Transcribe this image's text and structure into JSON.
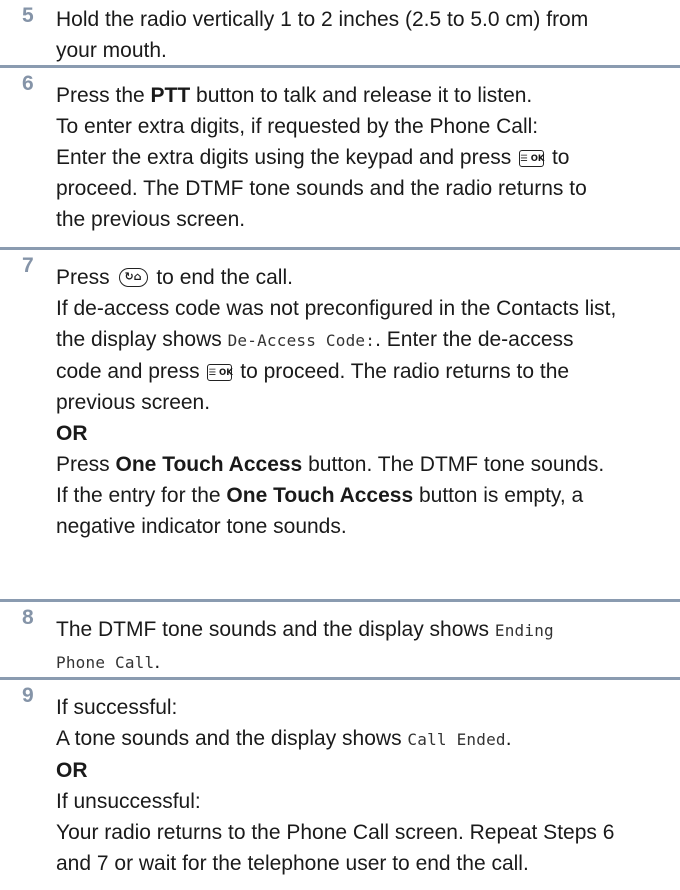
{
  "steps": [
    {
      "num": "5",
      "lines": [
        "Hold the radio vertically 1 to 2 inches (2.5 to 5.0 cm) from",
        "your mouth."
      ]
    },
    {
      "num": "6",
      "l1a": "Press the ",
      "l1b": "PTT",
      "l1c": " button to talk and release it to listen.",
      "l2": "To enter extra digits, if requested by the Phone Call:",
      "l3a": "Enter the extra digits using the keypad and press ",
      "l3b": " to",
      "l4": "proceed. The DTMF tone sounds and the radio returns to",
      "l5": "the previous screen."
    },
    {
      "num": "7",
      "l1a": "Press ",
      "l1b": " to end the call.",
      "l2": "If de-access code was not preconfigured in the Contacts list,",
      "l3a": "the display shows ",
      "l3mono": "De-Access Code:",
      "l3b": ". Enter the de-access",
      "l4a": "code and press ",
      "l4b": " to proceed. The radio returns to the",
      "l5": "previous screen.",
      "or": "OR",
      "l6a": "Press ",
      "l6b": "One Touch Access",
      "l6c": " button. The DTMF tone sounds.",
      "l7a": "If the entry for the ",
      "l7b": "One Touch Access",
      "l7c": " button is empty, a",
      "l8": "negative indicator tone sounds."
    },
    {
      "num": "8",
      "l1a": "The DTMF tone sounds and the display shows ",
      "l1mono": "Ending",
      "l2mono": "Phone Call",
      "l2b": "."
    },
    {
      "num": "9",
      "l1": "If successful:",
      "l2a": "A tone sounds and the display shows ",
      "l2mono": "Call Ended",
      "l2b": ".",
      "or": "OR",
      "l3": "If unsuccessful:",
      "l4": "Your radio returns to the Phone Call screen. Repeat Steps 6",
      "l5": "and 7 or wait for the telephone user to end the call."
    }
  ],
  "icons": {
    "ok_key": "menu-ok-key-icon",
    "ok_label": "☰ OK",
    "end_key": "end-home-key-icon",
    "end_label": "↻⌂"
  }
}
